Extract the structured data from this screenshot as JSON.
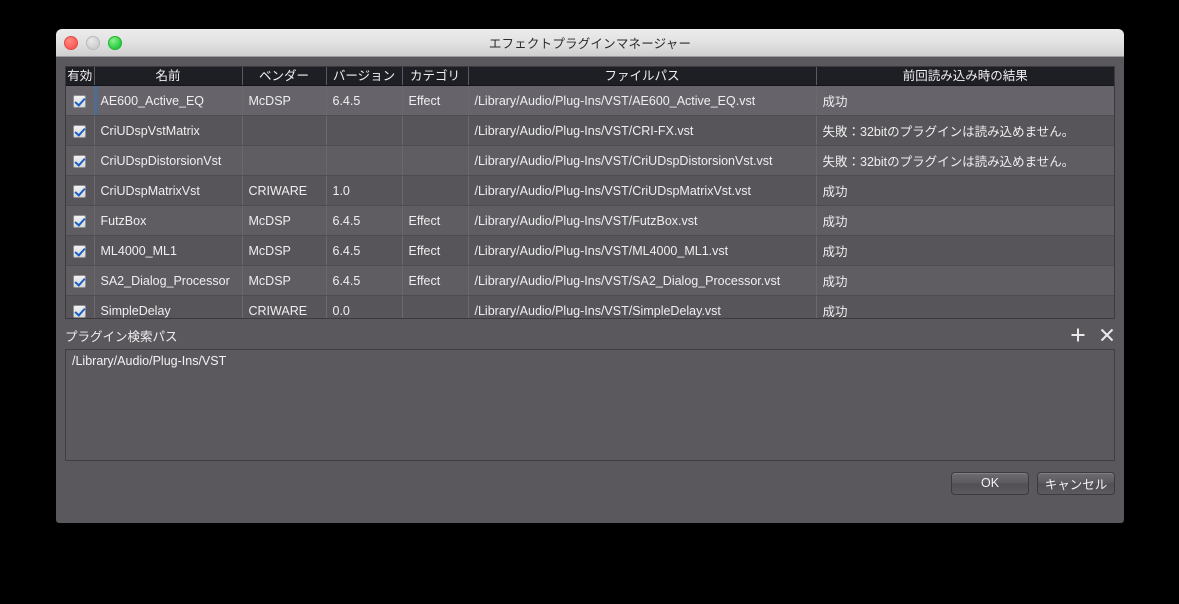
{
  "window": {
    "title": "エフェクトプラグインマネージャー",
    "traffic_lights": {
      "close": "close-button",
      "minimize": "minimize-button",
      "zoom": "zoom-button"
    }
  },
  "table": {
    "columns": [
      {
        "key": "enabled",
        "label": "有効"
      },
      {
        "key": "name",
        "label": "名前"
      },
      {
        "key": "vendor",
        "label": "ベンダー"
      },
      {
        "key": "version",
        "label": "バージョン"
      },
      {
        "key": "category",
        "label": "カテゴリ"
      },
      {
        "key": "path",
        "label": "ファイルパス"
      },
      {
        "key": "result",
        "label": "前回読み込み時の結果"
      }
    ],
    "rows": [
      {
        "enabled": true,
        "name": "AE600_Active_EQ",
        "vendor": "McDSP",
        "version": "6.4.5",
        "category": "Effect",
        "path": "/Library/Audio/Plug-Ins/VST/AE600_Active_EQ.vst",
        "result": "成功"
      },
      {
        "enabled": true,
        "name": "CriUDspVstMatrix",
        "vendor": "",
        "version": "",
        "category": "",
        "path": "/Library/Audio/Plug-Ins/VST/CRI-FX.vst",
        "result": "失敗：32bitのプラグインは読み込めません。"
      },
      {
        "enabled": true,
        "name": "CriUDspDistorsionVst",
        "vendor": "",
        "version": "",
        "category": "",
        "path": "/Library/Audio/Plug-Ins/VST/CriUDspDistorsionVst.vst",
        "result": "失敗：32bitのプラグインは読み込めません。"
      },
      {
        "enabled": true,
        "name": "CriUDspMatrixVst",
        "vendor": "CRIWARE",
        "version": "1.0",
        "category": "",
        "path": "/Library/Audio/Plug-Ins/VST/CriUDspMatrixVst.vst",
        "result": "成功"
      },
      {
        "enabled": true,
        "name": "FutzBox",
        "vendor": "McDSP",
        "version": "6.4.5",
        "category": "Effect",
        "path": "/Library/Audio/Plug-Ins/VST/FutzBox.vst",
        "result": "成功"
      },
      {
        "enabled": true,
        "name": "ML4000_ML1",
        "vendor": "McDSP",
        "version": "6.4.5",
        "category": "Effect",
        "path": "/Library/Audio/Plug-Ins/VST/ML4000_ML1.vst",
        "result": "成功"
      },
      {
        "enabled": true,
        "name": "SA2_Dialog_Processor",
        "vendor": "McDSP",
        "version": "6.4.5",
        "category": "Effect",
        "path": "/Library/Audio/Plug-Ins/VST/SA2_Dialog_Processor.vst",
        "result": "成功"
      },
      {
        "enabled": true,
        "name": "SimpleDelay",
        "vendor": "CRIWARE",
        "version": "0.0",
        "category": "",
        "path": "/Library/Audio/Plug-Ins/VST/SimpleDelay.vst",
        "result": "成功"
      }
    ]
  },
  "search_path": {
    "label": "プラグイン検索パス",
    "add_icon": "plus-icon",
    "remove_icon": "close-icon",
    "items": [
      "/Library/Audio/Plug-Ins/VST"
    ]
  },
  "footer": {
    "ok_label": "OK",
    "cancel_label": "キャンセル"
  },
  "colors": {
    "window_background": "#5a585c",
    "titlebar_top": "#ececec",
    "titlebar_bottom": "#cfcfcf",
    "header_background": "#1e1e25",
    "row_odd": "#5f5d62",
    "row_even": "#575559",
    "row_selected": "#66646a",
    "text": "#efeff0",
    "checkbox_check": "#1b5fc4",
    "traffic_close": "#fc5b57",
    "traffic_minimize": "#cfcfcf",
    "traffic_zoom": "#28cd41"
  }
}
